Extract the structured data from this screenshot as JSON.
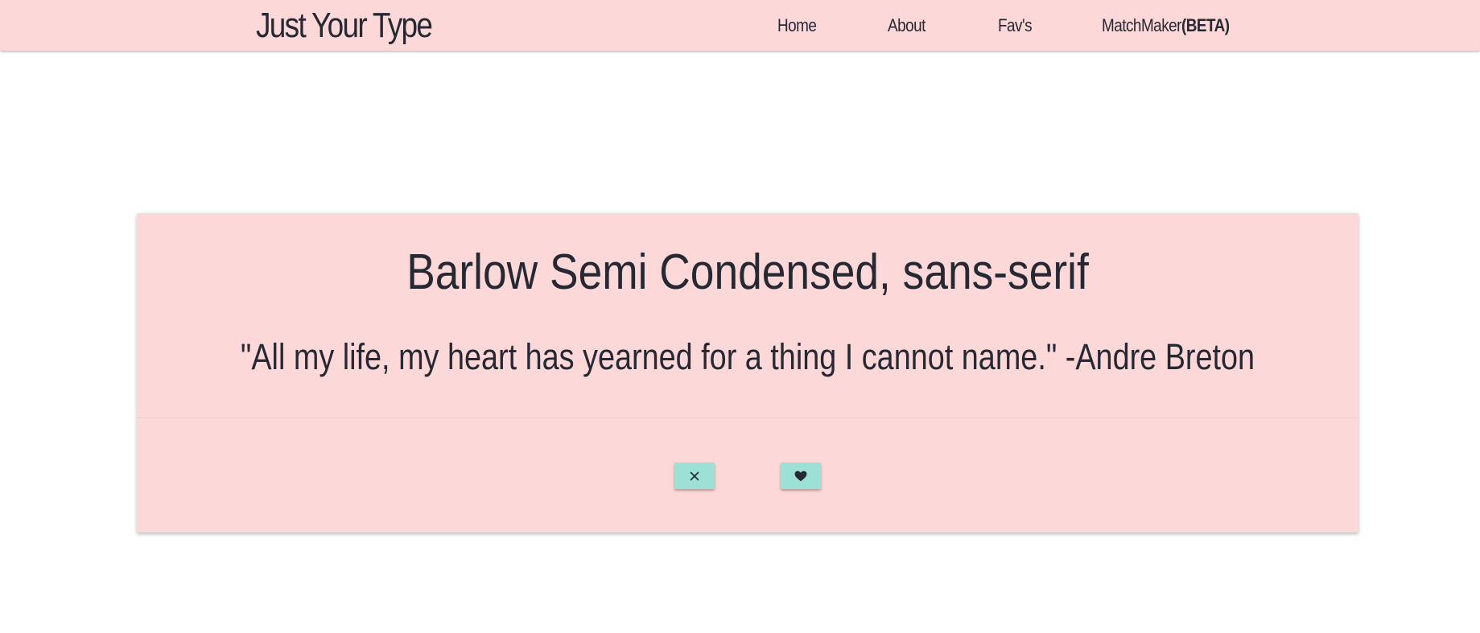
{
  "navbar": {
    "brand": "Just Your Type",
    "items": [
      {
        "label": "Home"
      },
      {
        "label": "About"
      },
      {
        "label": "Fav's"
      },
      {
        "label": "MatchMaker",
        "badge": "(BETA)"
      }
    ]
  },
  "card": {
    "font_name": "Barlow Semi Condensed, sans-serif",
    "quote": "\"All my life, my heart has yearned for a thing I cannot name.\" -Andre Breton",
    "buttons": {
      "reject_icon": "close-icon",
      "like_icon": "heart-icon"
    }
  },
  "colors": {
    "navbar_bg": "#fdd8d9",
    "card_bg": "#fdd8d9",
    "button_bg": "#9de0d6",
    "text": "#262833",
    "page_bg": "#ffffff"
  }
}
